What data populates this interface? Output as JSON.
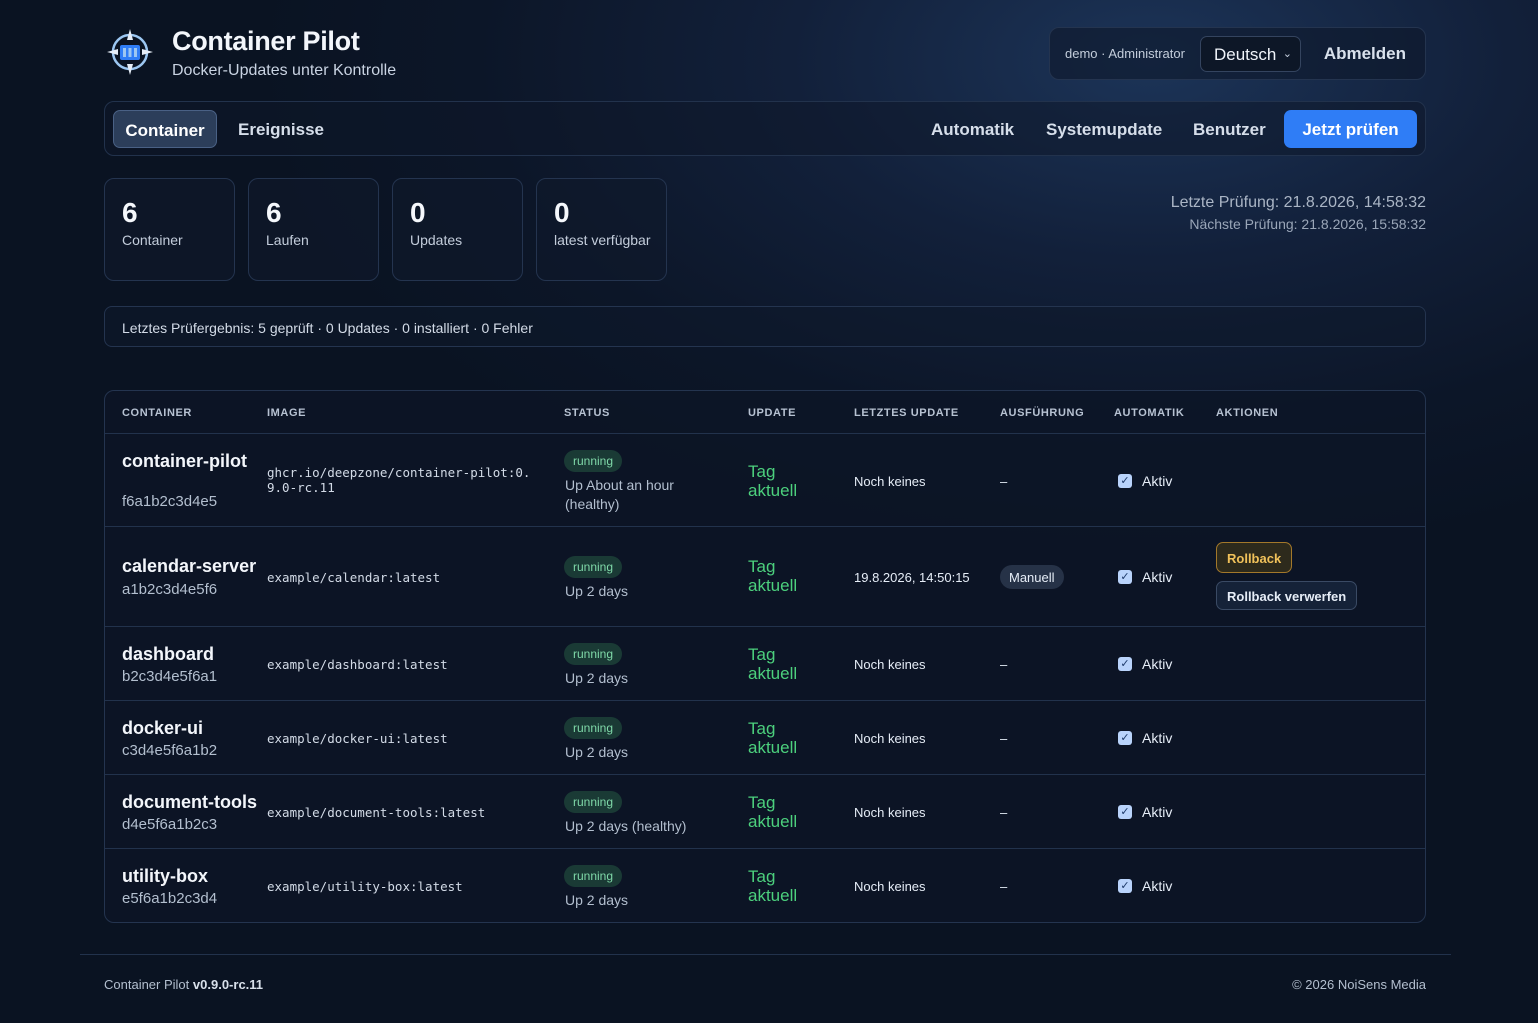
{
  "header": {
    "title": "Container Pilot",
    "subtitle": "Docker-Updates unter Kontrolle",
    "user_label": "demo · Administrator",
    "language": "Deutsch",
    "logout": "Abmelden"
  },
  "nav": {
    "tabs": [
      {
        "label": "Container",
        "active": true
      },
      {
        "label": "Ereignisse",
        "active": false
      }
    ],
    "right": [
      "Automatik",
      "Systemupdate",
      "Benutzer"
    ],
    "primary": "Jetzt prüfen"
  },
  "stats": [
    {
      "value": "6",
      "label": "Container"
    },
    {
      "value": "6",
      "label": "Laufen"
    },
    {
      "value": "0",
      "label": "Updates"
    },
    {
      "value": "0",
      "label": "latest verfügbar"
    }
  ],
  "checks": {
    "last": "Letzte Prüfung: 21.8.2026, 14:58:32",
    "next": "Nächste Prüfung: 21.8.2026, 15:58:32"
  },
  "result_text": "Letztes Prüfergebnis: 5 geprüft · 0 Updates · 0 installiert · 0 Fehler",
  "table": {
    "headers": [
      "CONTAINER",
      "IMAGE",
      "STATUS",
      "UPDATE",
      "LETZTES UPDATE",
      "AUSFÜHRUNG",
      "AUTOMATIK",
      "AKTIONEN"
    ],
    "rows": [
      {
        "name": "container-pilot",
        "id": "f6a1b2c3d4e5",
        "image": "ghcr.io/deepzone/container-pilot:0.9.0-rc.11",
        "status": "running",
        "uptime": "Up About an hour (healthy)",
        "update": "Tag aktuell",
        "last_update": "Noch keines",
        "execution": "–",
        "auto": "Aktiv"
      },
      {
        "name": "calendar-server",
        "id": "a1b2c3d4e5f6",
        "image": "example/calendar:latest",
        "status": "running",
        "uptime": "Up 2 days",
        "update": "Tag aktuell",
        "last_update": "19.8.2026, 14:50:15",
        "execution": "Manuell",
        "auto": "Aktiv",
        "actions": [
          "Rollback",
          "Rollback verwerfen"
        ]
      },
      {
        "name": "dashboard",
        "id": "b2c3d4e5f6a1",
        "image": "example/dashboard:latest",
        "status": "running",
        "uptime": "Up 2 days",
        "update": "Tag aktuell",
        "last_update": "Noch keines",
        "execution": "–",
        "auto": "Aktiv"
      },
      {
        "name": "docker-ui",
        "id": "c3d4e5f6a1b2",
        "image": "example/docker-ui:latest",
        "status": "running",
        "uptime": "Up 2 days",
        "update": "Tag aktuell",
        "last_update": "Noch keines",
        "execution": "–",
        "auto": "Aktiv"
      },
      {
        "name": "document-tools",
        "id": "d4e5f6a1b2c3",
        "image": "example/document-tools:latest",
        "status": "running",
        "uptime": "Up 2 days (healthy)",
        "update": "Tag aktuell",
        "last_update": "Noch keines",
        "execution": "–",
        "auto": "Aktiv"
      },
      {
        "name": "utility-box",
        "id": "e5f6a1b2c3d4",
        "image": "example/utility-box:latest",
        "status": "running",
        "uptime": "Up 2 days",
        "update": "Tag aktuell",
        "last_update": "Noch keines",
        "execution": "–",
        "auto": "Aktiv"
      }
    ]
  },
  "footer": {
    "app": "Container Pilot",
    "version": "v0.9.0-rc.11",
    "copyright": "© 2026 NoiSens Media"
  },
  "colors": {
    "accent": "#2f7df6",
    "success": "#4cd07d",
    "warning": "#f0c15a"
  }
}
